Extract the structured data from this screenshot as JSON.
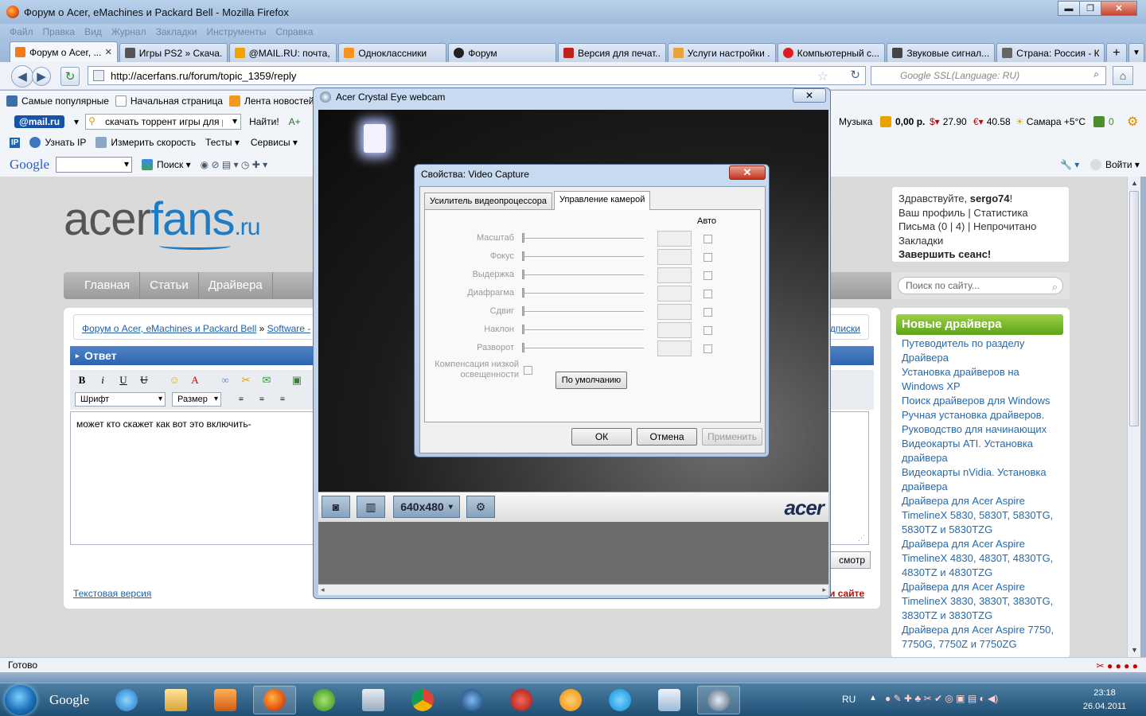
{
  "browser": {
    "title": "Форум о Acer, eMachines и Packard Bell - Mozilla Firefox",
    "menu": [
      "Файл",
      "Правка",
      "Вид",
      "Журнал",
      "Закладки",
      "Инструменты",
      "Справка"
    ],
    "tabs": [
      {
        "label": "Форум о Acer, ...",
        "color": "#f27a1a",
        "active": true
      },
      {
        "label": "Игры PS2 » Скача...",
        "color": "#555555"
      },
      {
        "label": "@MAIL.RU: почта, ...",
        "color": "#f2a100"
      },
      {
        "label": "Одноклассники",
        "color": "#f7931e"
      },
      {
        "label": "Форум",
        "color": "#222222"
      },
      {
        "label": "Версия для печат...",
        "color": "#c0231e"
      },
      {
        "label": "Услуги настройки ...",
        "color": "#e8a33c"
      },
      {
        "label": "Компьютерный с...",
        "color": "#d81e1e"
      },
      {
        "label": "Звуковые сигнал...",
        "color": "#444444"
      },
      {
        "label": "Страна: Россия - К...",
        "color": "#666666"
      }
    ],
    "url": "http://acerfans.ru/forum/topic_1359/reply",
    "search_placeholder": "Google SSL(Language: RU)",
    "bookmarks": [
      "Самые популярные",
      "Начальная страница",
      "Лента новостей"
    ],
    "mailru_bar": {
      "logo": "@mail.ru",
      "query": "скачать торрент игры для p",
      "find": "Найти!",
      "music": "Музыка",
      "balance": "0,00 р.",
      "usd": "27.90",
      "eur": "40.58",
      "weather": "Самара +5°C",
      "counter": "0"
    },
    "ip_bar": [
      "Узнать IP",
      "Измерить скорость",
      "Тесты",
      "Сервисы"
    ],
    "google_bar": {
      "logo": "Google",
      "search": "Поиск",
      "login": "Войти"
    },
    "status": "Готово"
  },
  "site": {
    "logo": {
      "part1": "acer",
      "part2": "fans",
      "part3": ".ru"
    },
    "nav": [
      "Главная",
      "Статьи",
      "Драйвера"
    ],
    "breadcrumb": {
      "link1": "Форум о Acer, eMachines и Packard Bell",
      "sep": "»",
      "link2": "Software -",
      "right": "одписки"
    },
    "reply_header": "Ответ",
    "font_select": "Шрифт",
    "size_select": "Размер",
    "message": "может кто скажет как вот это включить-",
    "preview_btn": "смотр",
    "text_version": "Текстовая версия",
    "site_link": "и сайте",
    "user": {
      "greeting": "Здравствуйте,",
      "name": "sergo74",
      "excl": "!",
      "profile": "Ваш профиль",
      "stats": "Статистика",
      "letters": "Письма (0 | 4)",
      "unread": "Непрочитано",
      "bookmarks": "Закладки",
      "logout": "Завершить сеанс!"
    },
    "search_placeholder": "Поиск по сайту...",
    "drivers_title": "Новые драйвера",
    "drivers": [
      "Путеводитель по разделу Драйвера",
      "Установка драйверов на Windows XP",
      "Поиск драйверов для Windows",
      "Ручная установка драйверов.",
      "Руководство для начинающих",
      "Видеокарты ATI. Установка драйвера",
      "Видеокарты nVidia. Установка драйвера",
      "Драйвера для Acer Aspire TimelineX 5830, 5830T, 5830TG, 5830TZ и 5830TZG",
      "Драйвера для Acer Aspire TimelineX 4830, 4830T, 4830TG, 4830TZ и 4830TZG",
      "Драйвера для Acer Aspire TimelineX 3830, 3830T, 3830TG, 3830TZ и 3830TZG",
      "Драйвера для Acer Aspire 7750, 7750G, 7750Z и 7750ZG"
    ]
  },
  "webcam": {
    "title": "Acer Crystal Eye webcam",
    "resolution": "640x480",
    "brand": "acer"
  },
  "props": {
    "title": "Свойства: Video Capture",
    "tabs": [
      "Усилитель видеопроцессора",
      "Управление камерой"
    ],
    "auto_label": "Авто",
    "rows": [
      "Масштаб",
      "Фокус",
      "Выдержка",
      "Диафрагма",
      "Сдвиг",
      "Наклон",
      "Разворот"
    ],
    "lowlight": "Компенсация низкой освещенности",
    "default_btn": "По умолчанию",
    "ok": "ОК",
    "cancel": "Отмена",
    "apply": "Применить"
  },
  "taskbar": {
    "google": "Google",
    "lang": "RU",
    "time": "23:18",
    "date": "26.04.2011"
  }
}
